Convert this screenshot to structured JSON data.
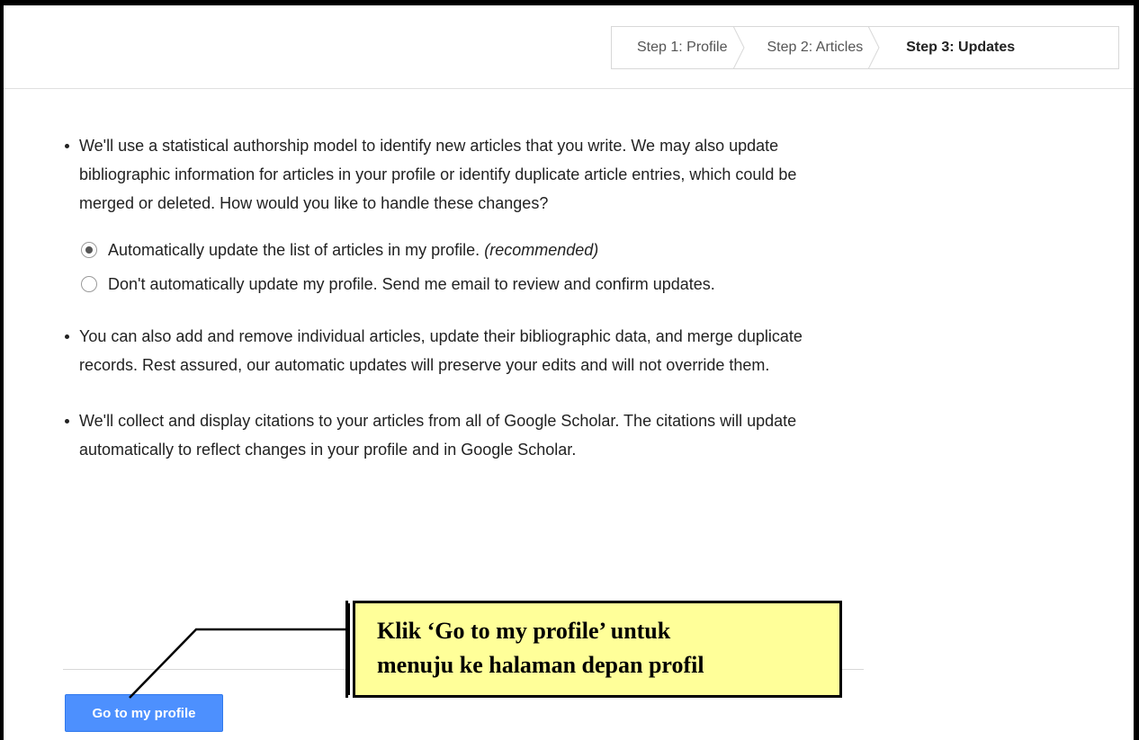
{
  "steps": [
    {
      "label": "Step 1: Profile",
      "active": false
    },
    {
      "label": "Step 2: Articles",
      "active": false
    },
    {
      "label": "Step 3: Updates",
      "active": true
    }
  ],
  "content": {
    "bullet_1": "We'll use a statistical authorship model to identify new articles that you write. We may also update bibliographic information for articles in your profile or identify duplicate article entries, which could be merged or deleted. How would you like to handle these changes?",
    "option_auto": {
      "label": "Automatically update the list of articles in my profile.",
      "note": "(recommended)",
      "selected": true
    },
    "option_manual": {
      "label": "Don't automatically update my profile. Send me email to review and confirm updates.",
      "selected": false
    },
    "bullet_2": "You can also add and remove individual articles, update their bibliographic data, and merge duplicate records. Rest assured, our automatic updates will preserve your edits and will not override them.",
    "bullet_3": "We'll collect and display citations to your articles from all of Google Scholar. The citations will update automatically to reflect changes in your profile and in Google Scholar."
  },
  "button": {
    "label": "Go to my profile"
  },
  "callout": {
    "line_1": "Klik ‘Go to my profile’ untuk",
    "line_2": "menuju ke halaman depan profil"
  },
  "colors": {
    "primary": "#4d90fe",
    "callout_bg": "#ffff99"
  }
}
